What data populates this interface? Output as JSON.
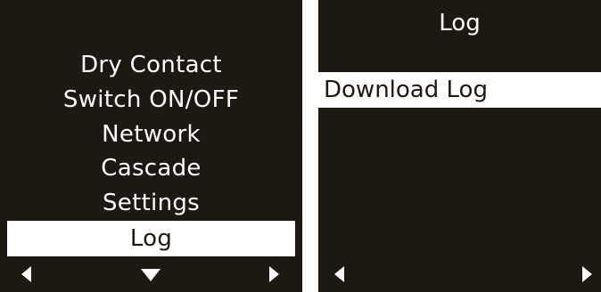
{
  "left_screen": {
    "menu_items": [
      {
        "label": "Dry Contact"
      },
      {
        "label": "Switch ON/OFF"
      },
      {
        "label": "Network"
      },
      {
        "label": "Cascade"
      },
      {
        "label": "Settings"
      },
      {
        "label": "Log"
      }
    ],
    "selected_item": "Log",
    "nav_icons": [
      "left-arrow-icon",
      "down-arrow-icon",
      "right-arrow-icon"
    ]
  },
  "right_screen": {
    "title": "Log",
    "items": [
      {
        "label": "Download Log"
      }
    ],
    "selected_item": "Download Log",
    "nav_icons": [
      "left-arrow-icon",
      "right-arrow-icon"
    ]
  },
  "colors": {
    "screen_background": "#1e1813",
    "text": "#ffffff",
    "highlight_background": "#ffffff",
    "highlight_text": "#1e1813"
  }
}
